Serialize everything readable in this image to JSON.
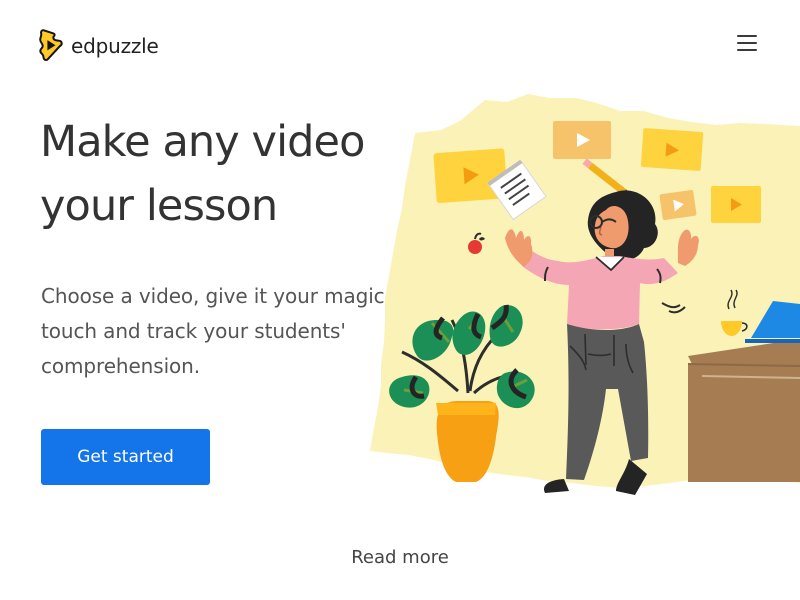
{
  "header": {
    "logo_text": "edpuzzle",
    "logo_icon": "puzzle-play-icon",
    "menu_icon": "hamburger-menu-icon"
  },
  "hero": {
    "title_lines": [
      "Make any video",
      "your lesson"
    ],
    "description_lines": [
      "Choose a video, give it your magic",
      "touch and track your students'",
      "comprehension."
    ],
    "primary_button_label": "Get started",
    "secondary_link_label": "Read more",
    "illustration": "teacher-with-videos-illustration"
  },
  "colors": {
    "brand_yellow": "#ffca28",
    "brand_blue": "#1474ea",
    "text_dark": "#333333",
    "text_muted": "#555555",
    "background": "#ffffff"
  }
}
